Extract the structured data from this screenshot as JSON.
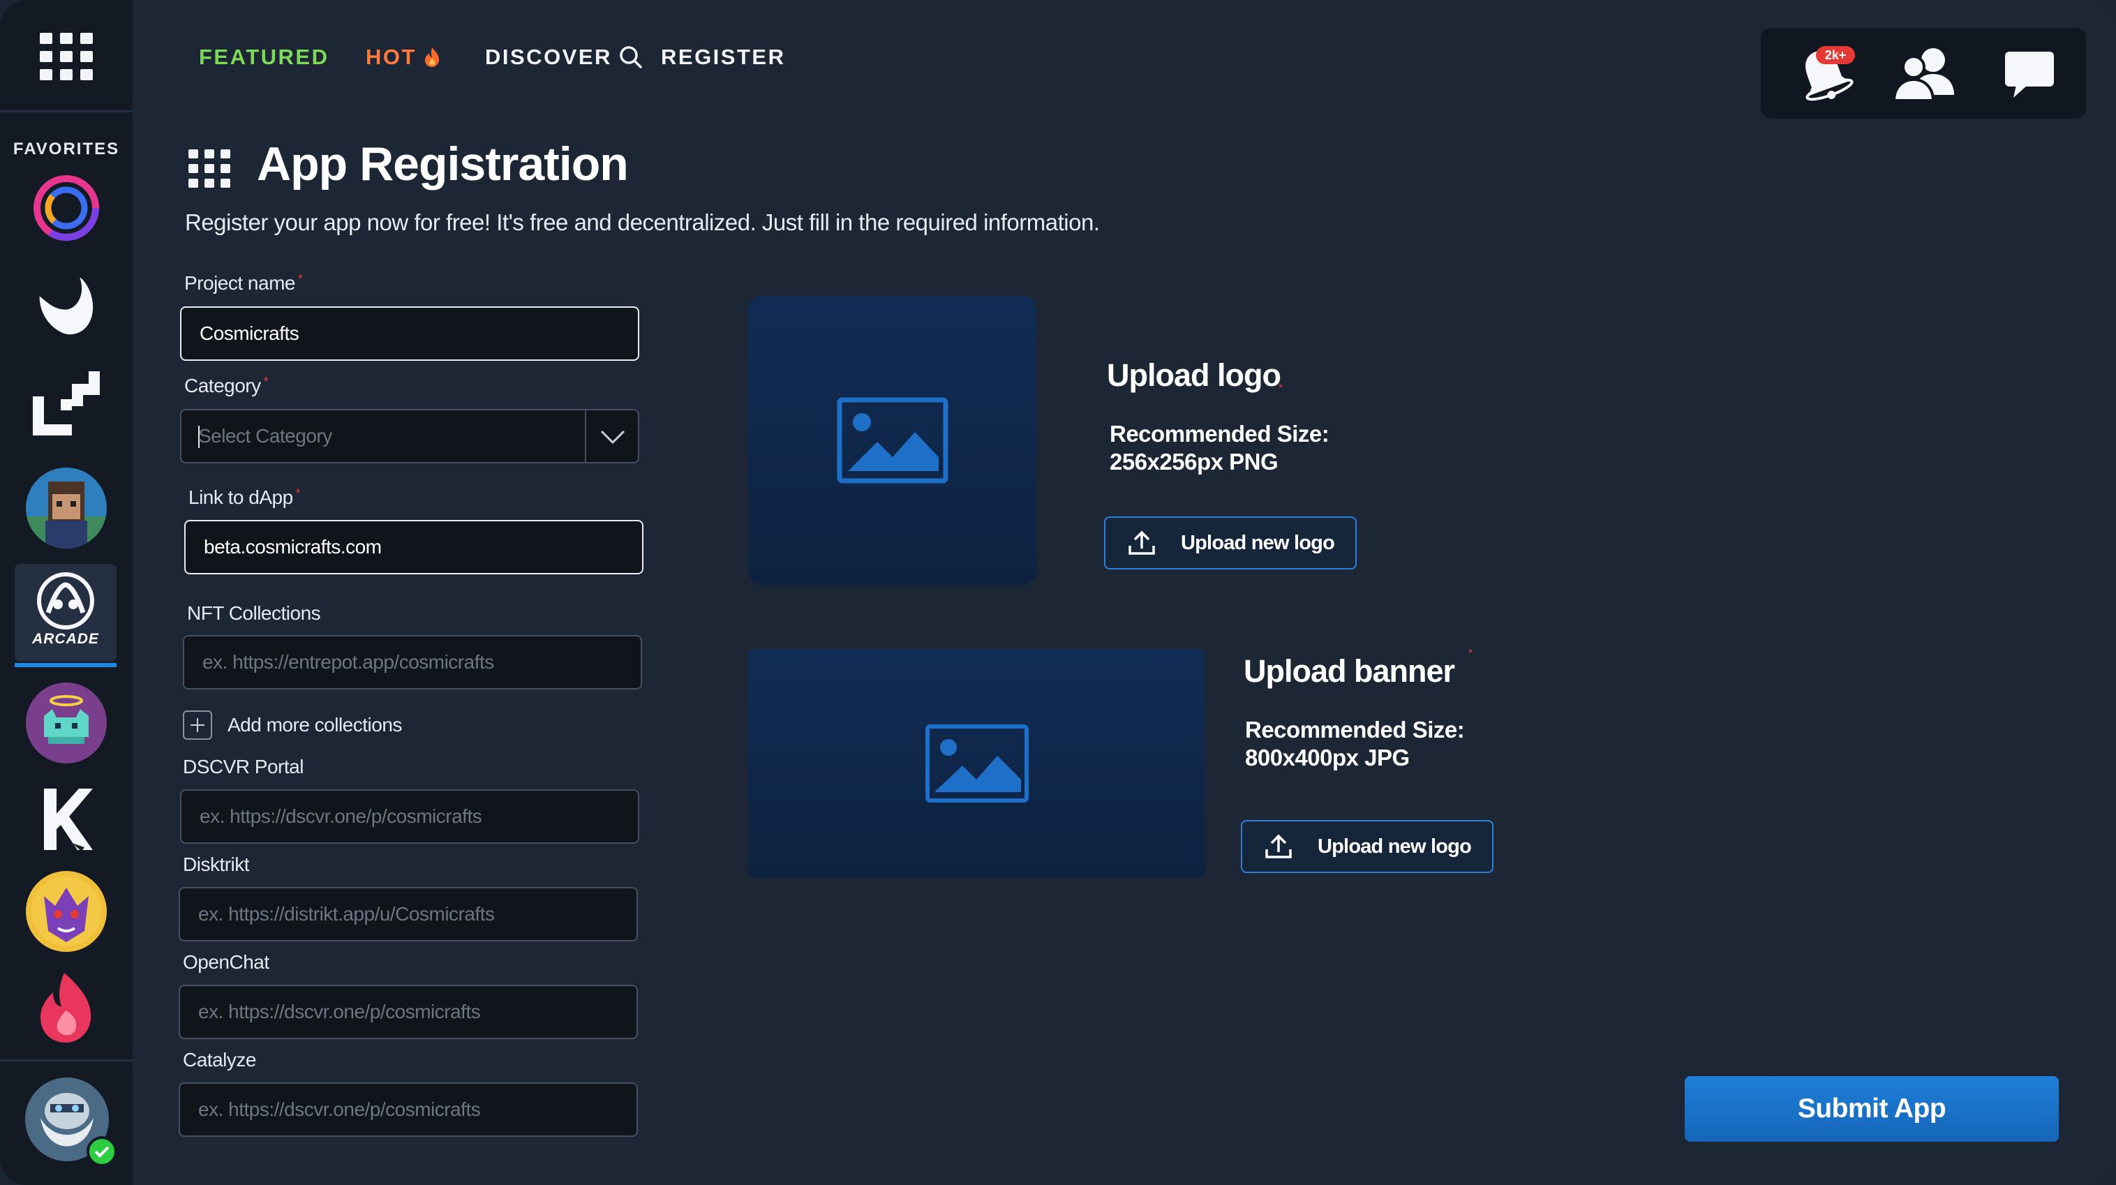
{
  "nav": {
    "featured": "FEATURED",
    "hot": "HOT",
    "discover": "DISCOVER",
    "register": "REGISTER"
  },
  "notifications": {
    "badge": "2k+"
  },
  "sidebar": {
    "favorites_label": "FAVORITES",
    "arcade_label": "ARCADE",
    "items": [
      "circle-logo-icon",
      "white-drop-logo-icon",
      "square-bracket-logo-icon",
      "pixel-avatar-icon",
      "arcade-logo-icon",
      "cat-avatar-icon",
      "k-logo-icon",
      "dragon-avatar-icon",
      "flame-logo-icon"
    ]
  },
  "page": {
    "title": "App Registration",
    "subtitle": "Register your app now for free! It's free and decentralized. Just fill in the required information."
  },
  "form": {
    "project_name": {
      "label": "Project name",
      "required": "*",
      "value": "Cosmicrafts"
    },
    "category": {
      "label": "Category",
      "required": "*",
      "placeholder": "Select Category"
    },
    "link": {
      "label": "Link to dApp",
      "required": "*",
      "value": "beta.cosmicrafts.com"
    },
    "nft": {
      "label": "NFT Collections",
      "placeholder": "ex. https://entrepot.app/cosmicrafts"
    },
    "add_more": "Add more collections",
    "dscvr": {
      "label": "DSCVR Portal",
      "placeholder": "ex. https://dscvr.one/p/cosmicrafts"
    },
    "distrikt": {
      "label": "Disktrikt",
      "placeholder": "ex. https://distrikt.app/u/Cosmicrafts"
    },
    "openchat": {
      "label": "OpenChat",
      "placeholder": "ex. https://dscvr.one/p/cosmicrafts"
    },
    "catalyze": {
      "label": "Catalyze",
      "placeholder": "ex. https://dscvr.one/p/cosmicrafts"
    }
  },
  "upload_logo": {
    "title": "Upload logo",
    "required": "*",
    "rec_line1": "Recommended Size:",
    "rec_line2": "256x256px PNG",
    "button": "Upload new logo"
  },
  "upload_banner": {
    "title": "Upload banner",
    "required": "*",
    "rec_line1": "Recommended Size:",
    "rec_line2": "800x400px JPG",
    "button": "Upload new logo"
  },
  "submit": "Submit App",
  "colors": {
    "background": "#1d2634",
    "sidebar": "#131a24",
    "accent": "#1e7fd8",
    "featured": "#7ed957",
    "hot": "#ff7a3d",
    "required": "#e53935"
  }
}
